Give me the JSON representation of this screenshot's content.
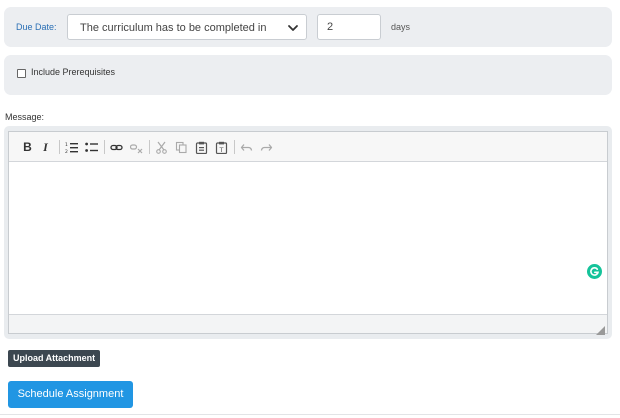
{
  "due_date": {
    "label": "Due Date:",
    "select_value": "The curriculum has to be completed in",
    "days_value": "2",
    "days_unit": "days"
  },
  "prerequisites": {
    "label": "Include Prerequisites",
    "checked": false
  },
  "message": {
    "label": "Message:",
    "toolbar": [
      {
        "name": "bold",
        "glyph": "B"
      },
      {
        "name": "italic",
        "glyph": "I"
      },
      {
        "name": "numbered-list"
      },
      {
        "name": "bulleted-list"
      },
      {
        "name": "link"
      },
      {
        "name": "unlink"
      },
      {
        "name": "cut"
      },
      {
        "name": "copy"
      },
      {
        "name": "paste"
      },
      {
        "name": "paste-text"
      },
      {
        "name": "undo"
      },
      {
        "name": "redo"
      }
    ],
    "body_text": ""
  },
  "buttons": {
    "upload_label": "Upload Attachment",
    "schedule_label": "Schedule Assignment"
  },
  "colors": {
    "panel_bg": "#eceef1",
    "label_blue": "#2a6fb5",
    "primary_button": "#2196e3",
    "dark_button": "#3c4750",
    "grammarly": "#15c39a"
  }
}
